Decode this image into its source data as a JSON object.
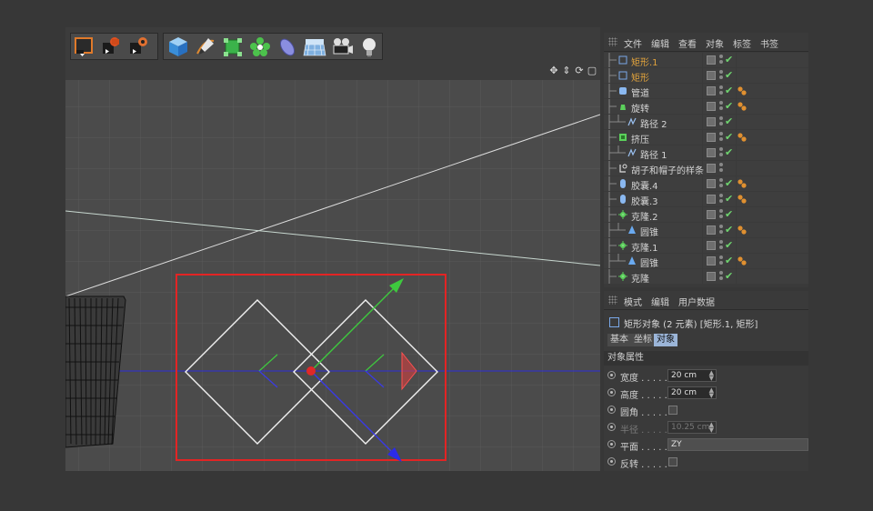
{
  "colors": {
    "background": "#373737",
    "viewport": "#4b4b4b",
    "selection_box": "#e32424",
    "axis_blue": "#2d2dd8",
    "axis_green": "#3ec93e",
    "selected_text": "#e0a23c",
    "active_tab": "#9bb5d8"
  },
  "toolbar": {
    "groups": [
      [
        "render-view-icon",
        "render-picture-icon",
        "render-settings-icon"
      ],
      [
        "cube-icon",
        "pen-spline-icon",
        "subdivision-icon",
        "cloner-icon",
        "deformer-icon",
        "floor-icon",
        "camera-icon",
        "light-icon"
      ]
    ]
  },
  "viewport": {
    "nav_icons": [
      "move-view-icon",
      "zoom-view-icon",
      "rotate-view-icon",
      "maximize-view-icon"
    ]
  },
  "object_manager": {
    "menu": [
      "文件",
      "编辑",
      "查看",
      "对象",
      "标签",
      "书签"
    ],
    "rows": [
      {
        "name": "矩形.1",
        "icon": "rectangle-icon",
        "selected": true,
        "indent": 0,
        "check": true,
        "tags": 0
      },
      {
        "name": "矩形",
        "icon": "rectangle-icon",
        "selected": true,
        "indent": 0,
        "check": true,
        "tags": 0
      },
      {
        "name": "管道",
        "icon": "tube-icon",
        "selected": false,
        "indent": 0,
        "check": true,
        "tags": 1
      },
      {
        "name": "旋转",
        "icon": "lathe-icon",
        "selected": false,
        "indent": 0,
        "check": true,
        "tags": 1
      },
      {
        "name": "路径 2",
        "icon": "spline-icon",
        "selected": false,
        "indent": 1,
        "check": true,
        "tags": 0
      },
      {
        "name": "挤压",
        "icon": "extrude-icon",
        "selected": false,
        "indent": 0,
        "check": true,
        "tags": 1
      },
      {
        "name": "路径 1",
        "icon": "spline-icon",
        "selected": false,
        "indent": 1,
        "check": true,
        "tags": 0
      },
      {
        "name": "胡子和帽子的样条",
        "icon": "null-icon",
        "selected": false,
        "indent": 0,
        "check": false,
        "tags": 0
      },
      {
        "name": "胶囊.4",
        "icon": "capsule-icon",
        "selected": false,
        "indent": 0,
        "check": true,
        "tags": 1
      },
      {
        "name": "胶囊.3",
        "icon": "capsule-icon",
        "selected": false,
        "indent": 0,
        "check": true,
        "tags": 1
      },
      {
        "name": "克隆.2",
        "icon": "cloner-icon",
        "selected": false,
        "indent": 0,
        "check": true,
        "tags": 0
      },
      {
        "name": "圆锥",
        "icon": "cone-icon",
        "selected": false,
        "indent": 1,
        "check": true,
        "tags": 1
      },
      {
        "name": "克隆.1",
        "icon": "cloner-icon",
        "selected": false,
        "indent": 0,
        "check": true,
        "tags": 0
      },
      {
        "name": "圆锥",
        "icon": "cone-icon",
        "selected": false,
        "indent": 1,
        "check": true,
        "tags": 1
      },
      {
        "name": "克隆",
        "icon": "cloner-icon",
        "selected": false,
        "indent": 0,
        "check": true,
        "tags": 0
      }
    ]
  },
  "attributes": {
    "menu": [
      "模式",
      "编辑",
      "用户数据"
    ],
    "title": "矩形对象 (2 元素) [矩形.1, 矩形]",
    "tabs": [
      {
        "label": "基本",
        "active": false
      },
      {
        "label": "坐标",
        "active": false
      },
      {
        "label": "对象",
        "active": true
      }
    ],
    "section": "对象属性",
    "props": [
      {
        "label": "宽度 . . . . .",
        "type": "number",
        "value": "20 cm",
        "dim": false
      },
      {
        "label": "高度 . . . . .",
        "type": "number",
        "value": "20 cm",
        "dim": false
      },
      {
        "label": "圆角 . . . . .",
        "type": "checkbox",
        "value": "",
        "dim": false
      },
      {
        "label": "半径 . . . . .",
        "type": "number",
        "value": "10.25 cm",
        "dim": true
      },
      {
        "label": "平面 . . . . .",
        "type": "select",
        "value": "ZY",
        "dim": false
      },
      {
        "label": "反转 . . . . .",
        "type": "checkbox",
        "value": "",
        "dim": false
      }
    ]
  }
}
